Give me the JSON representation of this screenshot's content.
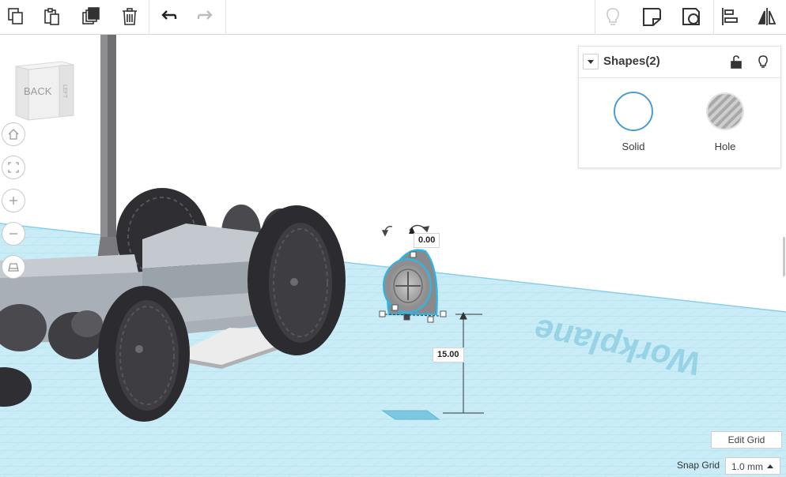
{
  "toolbar": {
    "left_buttons": [
      "copy-icon",
      "paste-icon",
      "duplicate-icon",
      "delete-icon",
      "undo-icon",
      "redo-icon"
    ],
    "right_buttons": [
      "lightbulb-icon",
      "note-icon",
      "shape-view-icon",
      "align-icon",
      "mirror-icon"
    ]
  },
  "viewcube": {
    "front": "BACK",
    "side": "LEFT"
  },
  "shapes_panel": {
    "title": "Shapes(2)",
    "solid_label": "Solid",
    "hole_label": "Hole",
    "solid_color": "#4a9bd6",
    "hole_color": "#bdbdbd"
  },
  "dimensions": {
    "rotation": "0.00",
    "elevation": "15.00"
  },
  "grid": {
    "watermark": "Workplane",
    "edit_label": "Edit Grid",
    "snap_label": "Snap Grid",
    "snap_value": "1.0 mm"
  },
  "colors": {
    "accent": "#1fb6e6",
    "workplane": "#bfe6f2",
    "grid_line": "#8fd3ea"
  }
}
